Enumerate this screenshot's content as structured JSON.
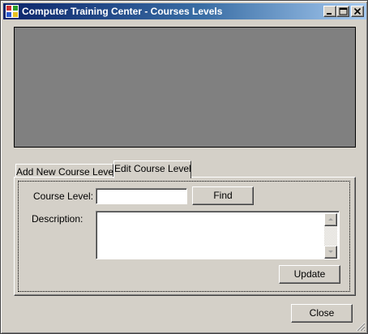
{
  "window": {
    "title": "Computer Training Center - Courses Levels"
  },
  "tabs": [
    {
      "label": "Add New Course Level",
      "selected": false
    },
    {
      "label": "Edit Course Level",
      "selected": true
    }
  ],
  "form": {
    "course_level_label": "Course Level:",
    "course_level_value": "",
    "find_label": "Find",
    "description_label": "Description:",
    "description_value": "",
    "update_label": "Update"
  },
  "footer": {
    "close_label": "Close"
  },
  "colors": {
    "title_gradient_start": "#0a246a",
    "title_gradient_end": "#a6caf0",
    "face": "#d4d0c8",
    "image_area": "#808080"
  }
}
